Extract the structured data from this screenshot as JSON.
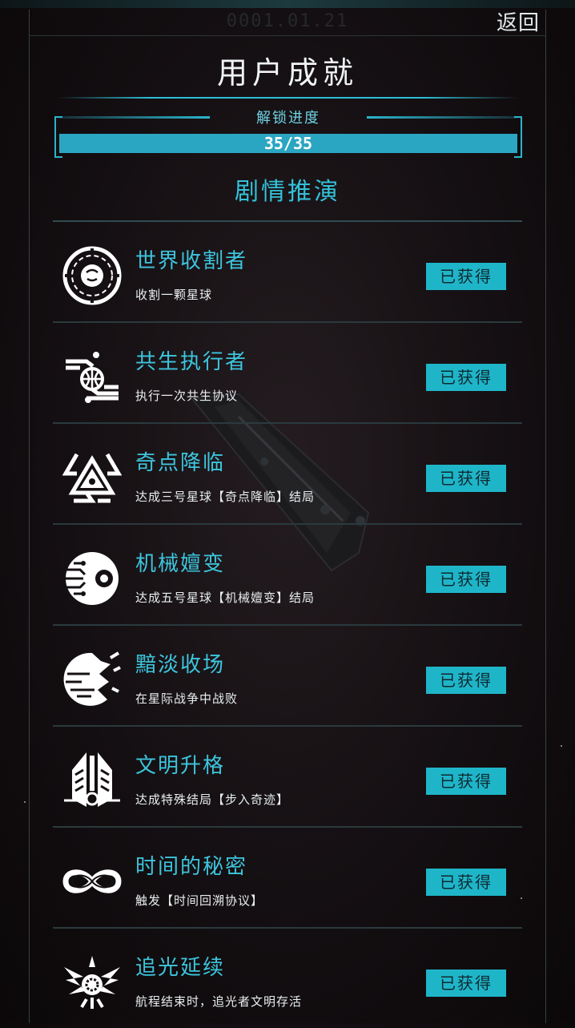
{
  "header": {
    "clock": "0001.01.21",
    "back_label": "返回",
    "title": "用户成就"
  },
  "progress": {
    "label": "解锁进度",
    "text": "35/35",
    "fraction": 1.0
  },
  "section": {
    "title": "剧情推演"
  },
  "achievements": [
    {
      "name": "世界收割者",
      "desc": "收割一颗星球",
      "status": "已获得",
      "icon": "planet-harvest-icon"
    },
    {
      "name": "共生执行者",
      "desc": "执行一次共生协议",
      "status": "已获得",
      "icon": "hands-globe-icon"
    },
    {
      "name": "奇点降临",
      "desc": "达成三号星球【奇点降临】结局",
      "status": "已获得",
      "icon": "triangle-eye-icon"
    },
    {
      "name": "机械嬗变",
      "desc": "达成五号星球【机械嬗变】结局",
      "status": "已获得",
      "icon": "circuit-eye-icon"
    },
    {
      "name": "黯淡收场",
      "desc": "在星际战争中战败",
      "status": "已获得",
      "icon": "shattered-planet-icon"
    },
    {
      "name": "文明升格",
      "desc": "达成特殊结局【步入奇迹】",
      "status": "已获得",
      "icon": "winged-emblem-icon"
    },
    {
      "name": "时间的秘密",
      "desc": "触发【时间回溯协议】",
      "status": "已获得",
      "icon": "infinity-icon"
    },
    {
      "name": "追光延续",
      "desc": "航程结束时，追光者文明存活",
      "status": "已获得",
      "icon": "winged-sun-icon"
    }
  ],
  "colors": {
    "accent": "#33c2da",
    "badge_bg": "#1fb5c9",
    "background": "#140f12"
  }
}
